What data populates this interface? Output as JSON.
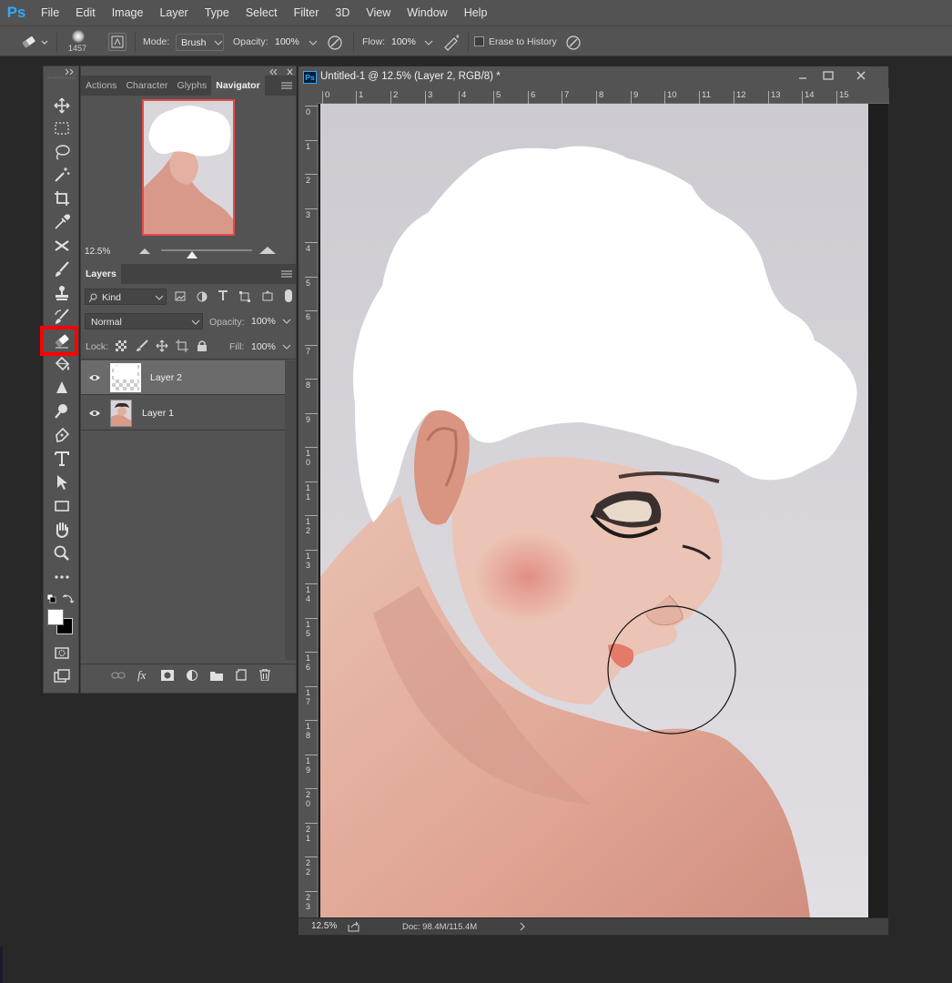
{
  "app": {
    "logo": "Ps",
    "menu": [
      "File",
      "Edit",
      "Image",
      "Layer",
      "Type",
      "Select",
      "Filter",
      "3D",
      "View",
      "Window",
      "Help"
    ]
  },
  "options": {
    "brush_size": "1457",
    "mode_label": "Mode:",
    "mode_value": "Brush",
    "opacity_label": "Opacity:",
    "opacity_value": "100%",
    "flow_label": "Flow:",
    "flow_value": "100%",
    "erase_history_label": "Erase to History"
  },
  "tools": {
    "active": "eraser-tool",
    "highlight_color": "#ff0000",
    "foreground_color": "#ffffff",
    "background_color": "#000000"
  },
  "navigator": {
    "tabs": [
      "Actions",
      "Character",
      "Glyphs",
      "Navigator"
    ],
    "active_tab": "Navigator",
    "zoom": "12.5%"
  },
  "layers_panel": {
    "tab": "Layers",
    "filter_kind": "Kind",
    "blend_mode": "Normal",
    "opacity_label": "Opacity:",
    "opacity_value": "100%",
    "lock_label": "Lock:",
    "fill_label": "Fill:",
    "fill_value": "100%",
    "layers": [
      {
        "name": "Layer 2",
        "selected": true
      },
      {
        "name": "Layer 1",
        "selected": false
      }
    ]
  },
  "document": {
    "tab_icon": "Ps",
    "title": "Untitled-1 @ 12.5% (Layer 2, RGB/8) *",
    "ruler_h": [
      "0",
      "1",
      "2",
      "3",
      "4",
      "5",
      "6",
      "7",
      "8",
      "9",
      "10",
      "11",
      "12",
      "13",
      "14",
      "15"
    ],
    "ruler_v": [
      "0",
      "1",
      "2",
      "3",
      "4",
      "5",
      "6",
      "7",
      "8",
      "9",
      "1\n0",
      "1\n1",
      "1\n2",
      "1\n3",
      "1\n4",
      "1\n5",
      "1\n6",
      "1\n7",
      "1\n8",
      "1\n9",
      "2\n0",
      "2\n1",
      "2\n2",
      "2\n3"
    ],
    "status_zoom": "12.5%",
    "status_doc": "Doc: 98.4M/115.4M"
  }
}
